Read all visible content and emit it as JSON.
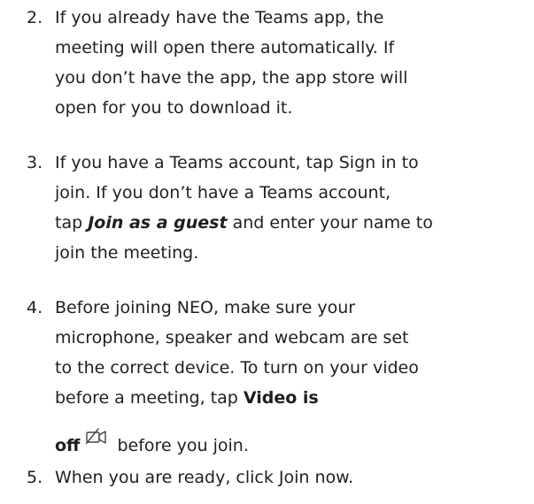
{
  "steps": [
    {
      "number": "2.",
      "lines": [
        "If you already have the Teams app, the",
        "meeting will open there automatically. If",
        "you don’t have the app, the app store will",
        "open for you to download it."
      ]
    },
    {
      "number": "3.",
      "lines": [
        "If you have a Teams account, tap Sign in to",
        "join. If you don’t have a Teams account,",
        "join the meeting."
      ],
      "line3_prefix": "tap ",
      "line3_bold": "Join as a guest",
      "line3_suffix": " and enter your name to"
    },
    {
      "number": "4.",
      "lines": [
        "Before joining NEO, make sure your",
        "microphone, speaker and webcam are set",
        "to the correct device. To turn on your video",
        "before a meeting, tap "
      ],
      "bold_1": "Video is",
      "bold_2": "off",
      "after_icon": " before you join.",
      "icon": "video-off-icon"
    },
    {
      "number": "5.",
      "lines": [
        "When you are ready, click Join now."
      ]
    }
  ]
}
